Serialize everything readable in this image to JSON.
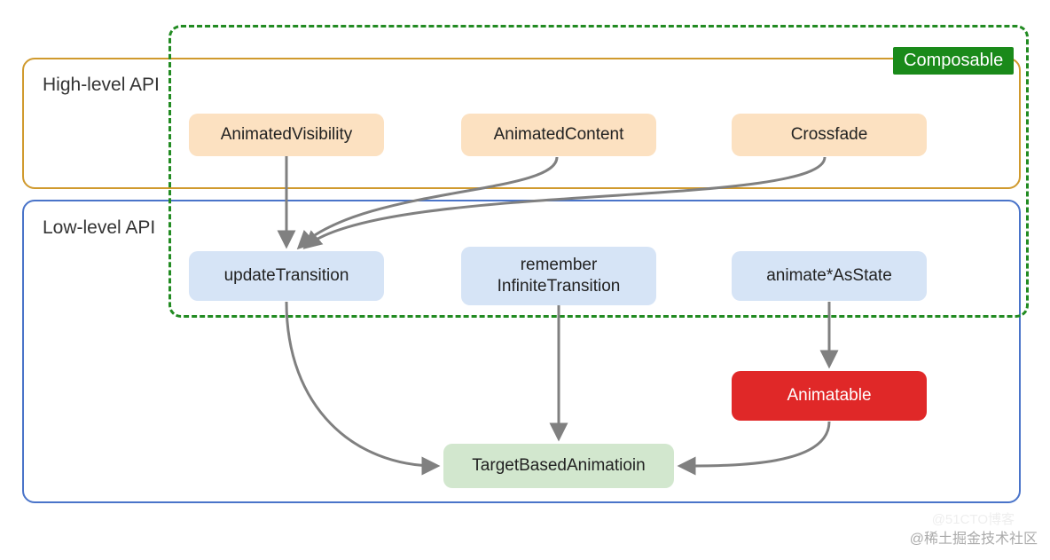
{
  "sections": {
    "high_label": "High-level API",
    "low_label": "Low-level API"
  },
  "badge": {
    "composable": "Composable"
  },
  "nodes": {
    "animated_visibility": "AnimatedVisibility",
    "animated_content": "AnimatedContent",
    "crossfade": "Crossfade",
    "update_transition": "updateTransition",
    "remember_infinite": "remember\nInfiniteTransition",
    "animate_as_state": "animate*AsState",
    "animatable": "Animatable",
    "target_based": "TargetBasedAnimatioin"
  },
  "watermark": {
    "faint": "@51CTO博客",
    "cn": "@稀土掘金技术社区"
  },
  "colors": {
    "orange": "#fce1c1",
    "blue": "#d6e4f6",
    "green_node": "#d2e7ce",
    "red": "#e02828",
    "high_border": "#d09a2e",
    "low_border": "#4a74c9",
    "composable_border": "#228b22",
    "badge_bg": "#1a8a1a",
    "arrow": "#808080"
  },
  "edges": [
    {
      "from": "animated_visibility",
      "to": "update_transition"
    },
    {
      "from": "animated_content",
      "to": "update_transition"
    },
    {
      "from": "crossfade",
      "to": "update_transition"
    },
    {
      "from": "update_transition",
      "to": "target_based"
    },
    {
      "from": "remember_infinite",
      "to": "target_based"
    },
    {
      "from": "animate_as_state",
      "to": "animatable"
    },
    {
      "from": "animatable",
      "to": "target_based"
    }
  ]
}
